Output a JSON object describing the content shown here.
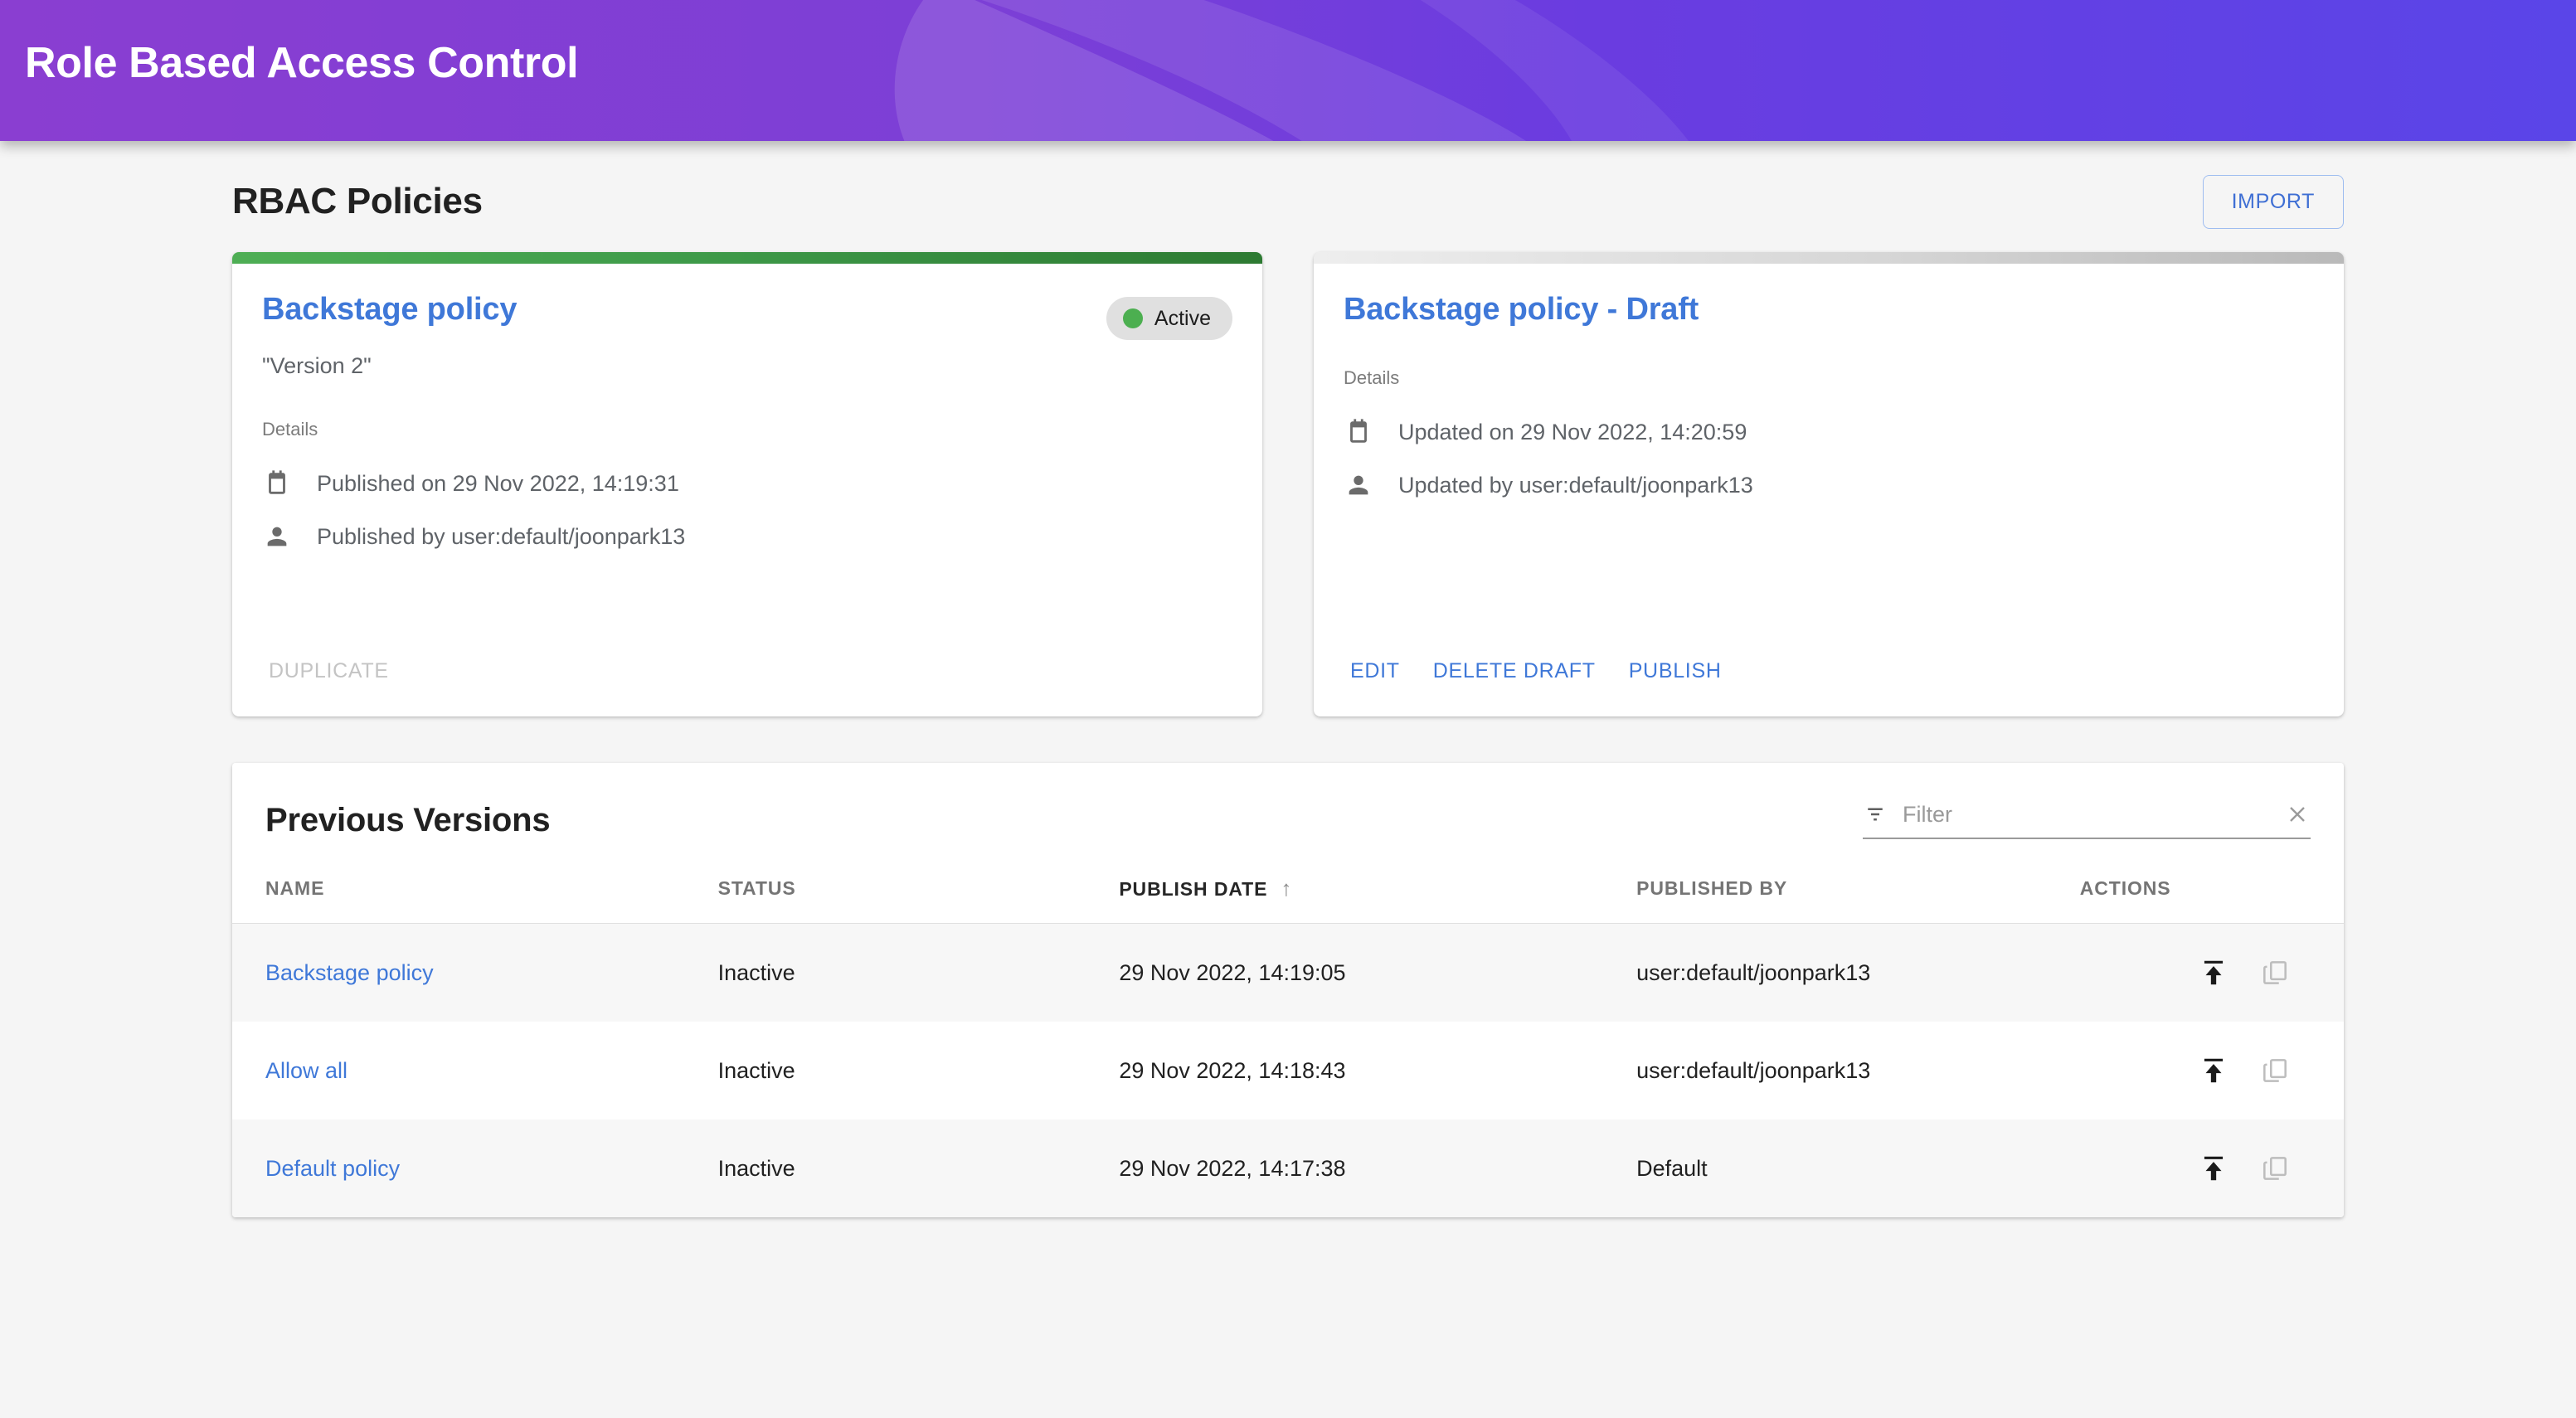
{
  "header": {
    "title": "Role Based Access Control",
    "gradient_from": "#8a3ed1",
    "gradient_to": "#5a45e8"
  },
  "page": {
    "title": "RBAC Policies",
    "import_label": "IMPORT",
    "accent_blue": "#3f78d8",
    "background": "#f5f5f5"
  },
  "cards": [
    {
      "title": "Backstage policy",
      "subtitle": "\"Version 2\"",
      "status": {
        "label": "Active",
        "dot_color": "#4caf50",
        "chip_bg": "#e0e0e0"
      },
      "topbar_color": "#3e9a49",
      "details_label": "Details",
      "details": [
        {
          "icon": "calendar-icon",
          "text": "Published on 29 Nov 2022, 14:19:31"
        },
        {
          "icon": "person-icon",
          "text": "Published by user:default/joonpark13"
        }
      ],
      "actions": [
        {
          "label": "DUPLICATE",
          "disabled": true
        }
      ]
    },
    {
      "title": "Backstage policy - Draft",
      "subtitle": "",
      "status": null,
      "topbar_color": "#bdbdbd",
      "details_label": "Details",
      "details": [
        {
          "icon": "calendar-icon",
          "text": "Updated on 29 Nov 2022, 14:20:59"
        },
        {
          "icon": "person-icon",
          "text": "Updated by user:default/joonpark13"
        }
      ],
      "actions": [
        {
          "label": "EDIT",
          "disabled": false
        },
        {
          "label": "DELETE DRAFT",
          "disabled": false
        },
        {
          "label": "PUBLISH",
          "disabled": false
        }
      ]
    }
  ],
  "versions_table": {
    "heading": "Previous Versions",
    "filter": {
      "placeholder": "Filter",
      "value": ""
    },
    "columns": [
      {
        "key": "name",
        "label": "NAME",
        "sorted": false
      },
      {
        "key": "status",
        "label": "STATUS",
        "sorted": false
      },
      {
        "key": "publish_date",
        "label": "PUBLISH DATE",
        "sorted": true,
        "sort_arrow": "↑"
      },
      {
        "key": "published_by",
        "label": "PUBLISHED BY",
        "sorted": false
      },
      {
        "key": "actions",
        "label": "ACTIONS",
        "sorted": false
      }
    ],
    "rows": [
      {
        "name": "Backstage policy",
        "status": "Inactive",
        "publish_date": "29 Nov 2022, 14:19:05",
        "published_by": "user:default/joonpark13",
        "actions": [
          "publish-icon",
          "copy-icon"
        ]
      },
      {
        "name": "Allow all",
        "status": "Inactive",
        "publish_date": "29 Nov 2022, 14:18:43",
        "published_by": "user:default/joonpark13",
        "actions": [
          "publish-icon",
          "copy-icon"
        ]
      },
      {
        "name": "Default policy",
        "status": "Inactive",
        "publish_date": "29 Nov 2022, 14:17:38",
        "published_by": "Default",
        "actions": [
          "publish-icon",
          "copy-icon"
        ]
      }
    ]
  }
}
